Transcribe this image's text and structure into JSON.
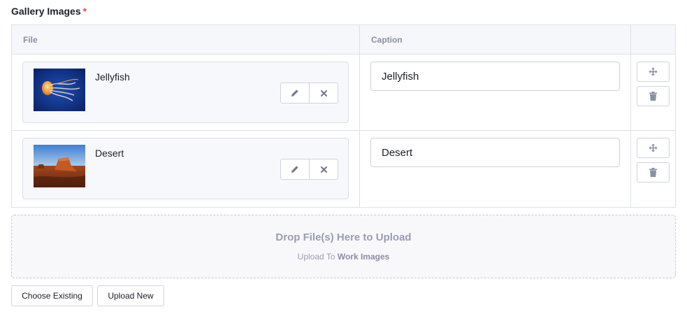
{
  "field": {
    "label": "Gallery Images",
    "required_mark": "*"
  },
  "table": {
    "headers": {
      "file": "File",
      "caption": "Caption",
      "actions": ""
    },
    "rows": [
      {
        "file_name": "Jellyfish",
        "thumbnail": "jellyfish-image",
        "caption": "Jellyfish"
      },
      {
        "file_name": "Desert",
        "thumbnail": "desert-image",
        "caption": "Desert"
      }
    ]
  },
  "icons": {
    "edit": "pencil-icon",
    "remove": "close-icon",
    "move": "move-icon",
    "delete": "trash-icon"
  },
  "dropzone": {
    "title": "Drop File(s) Here to Upload",
    "sub_prefix": "Upload To",
    "sub_target": "Work Images"
  },
  "buttons": {
    "choose_existing": "Choose Existing",
    "upload_new": "Upload New"
  },
  "colors": {
    "required": "#e5484d",
    "muted_text": "#8a8fa3",
    "border": "#dfe1e8"
  }
}
